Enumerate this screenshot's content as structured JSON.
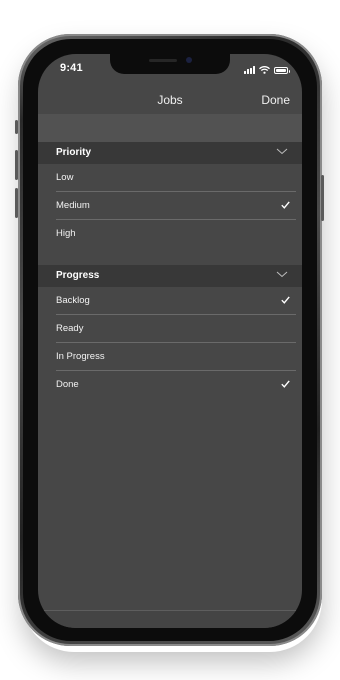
{
  "status_bar": {
    "time": "9:41",
    "icons": [
      "cellular-signal-icon",
      "wifi-icon",
      "battery-icon"
    ]
  },
  "nav": {
    "title": "Jobs",
    "done_label": "Done"
  },
  "sections": [
    {
      "title": "Priority",
      "icon": "chevron-down-icon",
      "options": [
        {
          "label": "Low",
          "checked": false
        },
        {
          "label": "Medium",
          "checked": true
        },
        {
          "label": "High",
          "checked": false
        }
      ]
    },
    {
      "title": "Progress",
      "icon": "chevron-down-icon",
      "options": [
        {
          "label": "Backlog",
          "checked": true
        },
        {
          "label": "Ready",
          "checked": false
        },
        {
          "label": "In Progress",
          "checked": false
        },
        {
          "label": "Done",
          "checked": true
        }
      ]
    }
  ],
  "colors": {
    "screen_bg": "#474747",
    "section_header_bg": "#383838",
    "text": "#ffffff"
  }
}
